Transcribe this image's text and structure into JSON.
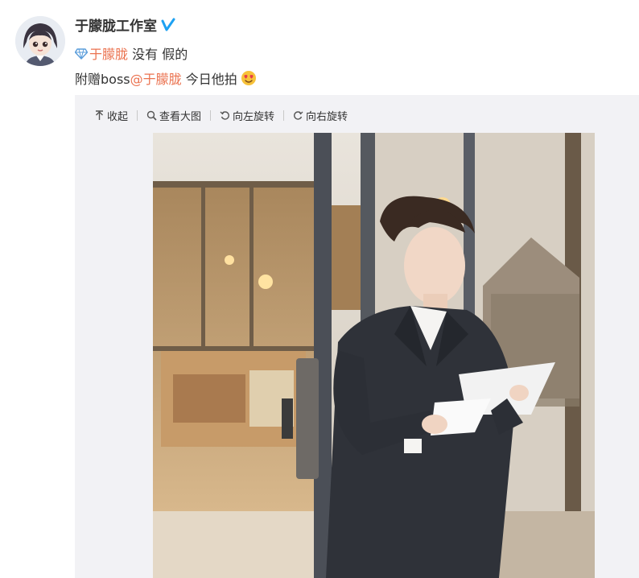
{
  "post": {
    "username": "于朦胧工作室",
    "verified_icon": "verified-badge-icon",
    "line1": {
      "mention_icon": "diamond-icon",
      "mention": "于朦胧",
      "text": " 没有 假的"
    },
    "line2": {
      "prefix": "附赠boss",
      "mention": "@于朦胧",
      "suffix": " 今日他拍",
      "emoji": "heart-eyes-emoji"
    }
  },
  "media_toolbar": {
    "collapse": "收起",
    "view_large": "查看大图",
    "rotate_left": "向左旋转",
    "rotate_right": "向右旋转"
  },
  "colors": {
    "mention": "#eb7350",
    "verified": "#1da1f2",
    "panel_bg": "#f2f2f5"
  }
}
